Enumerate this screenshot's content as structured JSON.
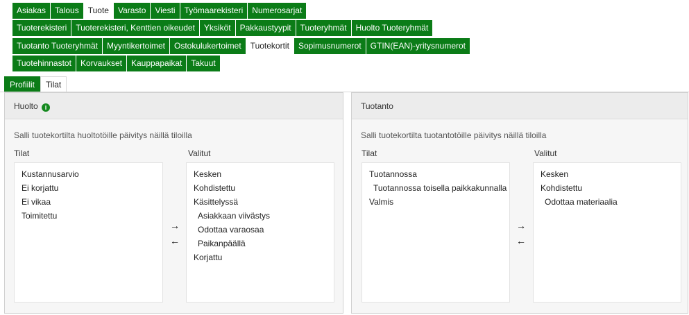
{
  "nav": {
    "row1": [
      {
        "label": "Asiakas"
      },
      {
        "label": "Talous"
      },
      {
        "label": "Tuote",
        "active": true
      },
      {
        "label": "Varasto"
      },
      {
        "label": "Viesti"
      },
      {
        "label": "Työmaarekisteri"
      },
      {
        "label": "Numerosarjat"
      }
    ],
    "row2": [
      {
        "label": "Tuoterekisteri"
      },
      {
        "label": "Tuoterekisteri, Kenttien oikeudet"
      },
      {
        "label": "Yksiköt"
      },
      {
        "label": "Pakkaustyypit"
      },
      {
        "label": "Tuoteryhmät"
      },
      {
        "label": "Huolto Tuoteryhmät"
      }
    ],
    "row3": [
      {
        "label": "Tuotanto Tuoteryhmät"
      },
      {
        "label": "Myyntikertoimet"
      },
      {
        "label": "Ostokulukertoimet"
      },
      {
        "label": "Tuotekortit",
        "active": true
      },
      {
        "label": "Sopimusnumerot"
      },
      {
        "label": "GTIN(EAN)-yritysnumerot"
      }
    ],
    "row4": [
      {
        "label": "Tuotehinnastot"
      },
      {
        "label": "Korvaukset"
      },
      {
        "label": "Kauppapaikat"
      },
      {
        "label": "Takuut"
      }
    ]
  },
  "sub_tabs": [
    {
      "label": "Profiilit",
      "active": true
    },
    {
      "label": "Tilat"
    }
  ],
  "huolto": {
    "title": "Huolto",
    "info_icon": "i",
    "description": "Salli tuotekortilta huoltotöille päivitys näillä tiloilla",
    "left_label": "Tilat",
    "right_label": "Valitut",
    "left_items": [
      "Kustannusarvio",
      "Ei korjattu",
      "Ei vikaa",
      "Toimitettu"
    ],
    "right_items": [
      {
        "label": "Kesken",
        "indent": false
      },
      {
        "label": "Kohdistettu",
        "indent": false
      },
      {
        "label": "Käsittelyssä",
        "indent": false
      },
      {
        "label": "Asiakkaan viivästys",
        "indent": true
      },
      {
        "label": "Odottaa varaosaa",
        "indent": true
      },
      {
        "label": "Paikanpäällä",
        "indent": true
      },
      {
        "label": "Korjattu",
        "indent": false
      }
    ]
  },
  "tuotanto": {
    "title": "Tuotanto",
    "description": "Salli tuotekortilta tuotantotöille päivitys näillä tiloilla",
    "left_label": "Tilat",
    "right_label": "Valitut",
    "left_items": [
      {
        "label": "Tuotannossa",
        "indent": false
      },
      {
        "label": "Tuotannossa toisella paikkakunnalla",
        "indent": true
      },
      {
        "label": "Valmis",
        "indent": false
      }
    ],
    "right_items": [
      {
        "label": "Kesken",
        "indent": false
      },
      {
        "label": "Kohdistettu",
        "indent": false
      },
      {
        "label": "Odottaa materiaalia",
        "indent": true
      }
    ]
  },
  "arrows": {
    "add": "→",
    "remove": "←"
  },
  "colors": {
    "accent": "#0b7c17",
    "panel_bg": "#f6f6f6",
    "header_bg": "#ececec"
  }
}
